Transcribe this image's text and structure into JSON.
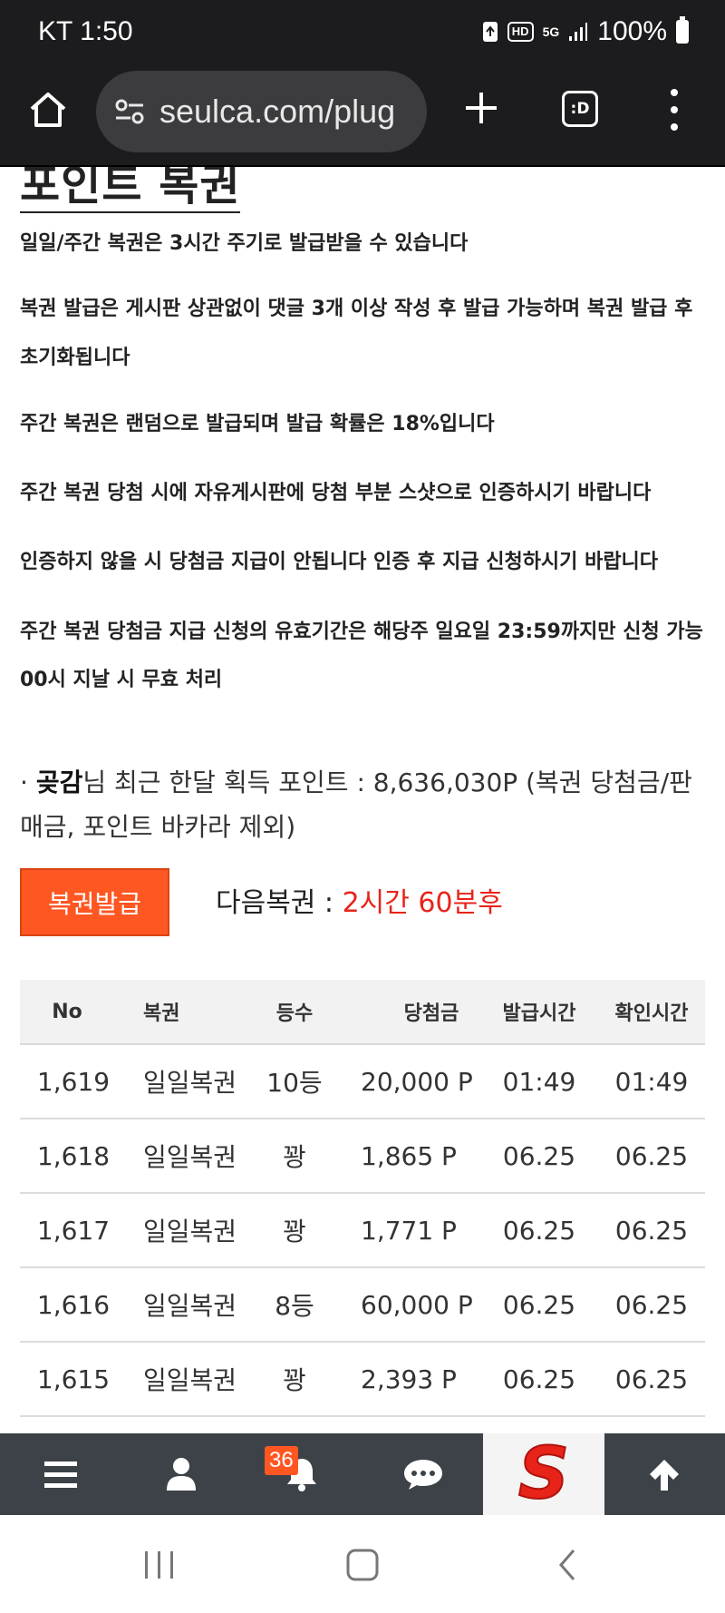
{
  "status_bar": {
    "carrier_time": "KT 1:50",
    "badge_hd": "HD",
    "badge_5g": "5G",
    "battery": "100%"
  },
  "browser": {
    "url": "seulca.com/plug",
    "tabs_label": ":D"
  },
  "page": {
    "title": "포인트 복권",
    "notices": [
      "일일/주간 복권은 3시간 주기로 발급받을 수 있습니다",
      "복권 발급은 게시판 상관없이 댓글 3개 이상 작성 후 발급 가능하며 복권 발급 후",
      "초기화됩니다",
      "주간 복권은 랜덤으로 발급되며 발급 확률은 18%입니다",
      "주간 복권 당첨 시에 자유게시판에 당첨 부분 스샷으로 인증하시기 바랍니다",
      "인증하지 않을 시 당첨금 지급이 안됩니다 인증 후 지급 신청하시기 바랍니다",
      "주간 복권 당첨금 지급 신청의 유효기간은 해당주 일요일 23:59까지만 신청 가능",
      "00시 지날 시 무효 처리"
    ],
    "monthly": {
      "bullet": "·",
      "nickname": "곶감",
      "text": "님 최근 한달 획득 포인트 : 8,636,030P (복권 당첨금/판매금, 포인트 바카라 제외)"
    },
    "issue_button": "복권발급",
    "next_label": "다음복권 : ",
    "next_value": "2시간 60분후"
  },
  "table": {
    "headers": [
      "No",
      "복권",
      "등수",
      "당첨금",
      "발급시간",
      "확인시간"
    ],
    "rows": [
      [
        "1,619",
        "일일복권",
        "10등",
        "20,000 P",
        "01:49",
        "01:49"
      ],
      [
        "1,618",
        "일일복권",
        "꽝",
        "1,865 P",
        "06.25",
        "06.25"
      ],
      [
        "1,617",
        "일일복권",
        "꽝",
        "1,771 P",
        "06.25",
        "06.25"
      ],
      [
        "1,616",
        "일일복권",
        "8등",
        "60,000 P",
        "06.25",
        "06.25"
      ],
      [
        "1,615",
        "일일복권",
        "꽝",
        "2,393 P",
        "06.25",
        "06.25"
      ]
    ]
  },
  "app_nav": {
    "items": [
      "menu-icon",
      "user-icon",
      "bell-icon",
      "chat-icon",
      "site-logo",
      "arrow-up-icon"
    ],
    "notification_count": "36",
    "logo_letter": "S",
    "accent": "#ff5722",
    "background": "#3d4248"
  },
  "colors": {
    "accent_orange": "#ff5722",
    "next_red": "#e8231a",
    "status_bg": "#1c1c1e"
  }
}
